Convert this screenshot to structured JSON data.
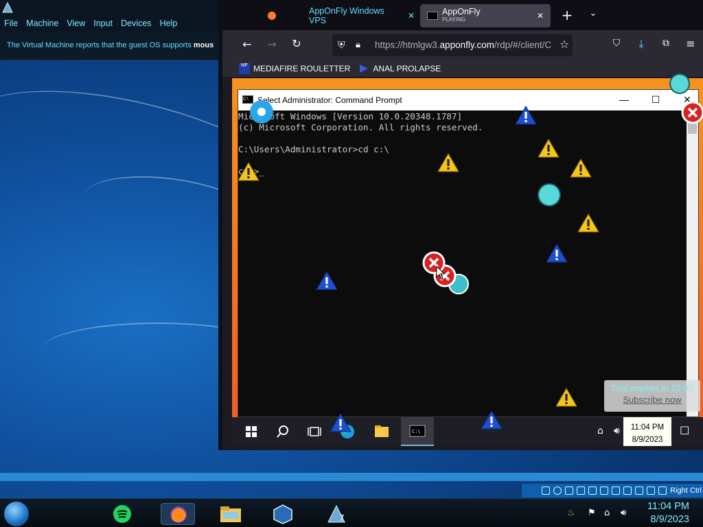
{
  "host": {
    "menus": [
      "File",
      "Machine",
      "View",
      "Input",
      "Devices",
      "Help"
    ],
    "notice": "The Virtual Machine reports that the guest OS supports ",
    "notice_bold": "mous",
    "status_right": "Right Ctrl",
    "clock_time": "11:04 PM",
    "clock_date": "8/9/2023"
  },
  "browser": {
    "tabs": [
      {
        "label": "AppOnFly Windows VPS",
        "active": false
      },
      {
        "label": "AppOnFly",
        "sub": "PLAYING",
        "active": true
      }
    ],
    "url_prefix": "https://htmlgw3.",
    "url_domain": "apponfly.com",
    "url_suffix": "/rdp/#/client/C",
    "bookmarks": [
      {
        "label": "MEDIAFIRE ROULETTER",
        "icon": "MF"
      },
      {
        "label": "ANAL PROLAPSE",
        "icon": "chevron"
      }
    ]
  },
  "cmd": {
    "title": "Select Administrator: Command Prompt",
    "lines": [
      "Microsoft Windows [Version 10.0.20348.1787]",
      "(c) Microsoft Corporation. All rights reserved.",
      "",
      "C:\\Users\\Administrator>cd c:\\",
      "",
      "c:\\>"
    ]
  },
  "server": {
    "clock_time": "11:04 PM",
    "clock_date": "8/9/2023",
    "trial_text": "Trial expires in 23:02",
    "subscribe": "Subscribe now"
  },
  "colors": {
    "accent_cyan": "#5fe0ff",
    "rdp_orange": "#f7931e",
    "warn_yellow": "#f5c518",
    "info_blue": "#1f4fd1",
    "error_red": "#d92121"
  }
}
